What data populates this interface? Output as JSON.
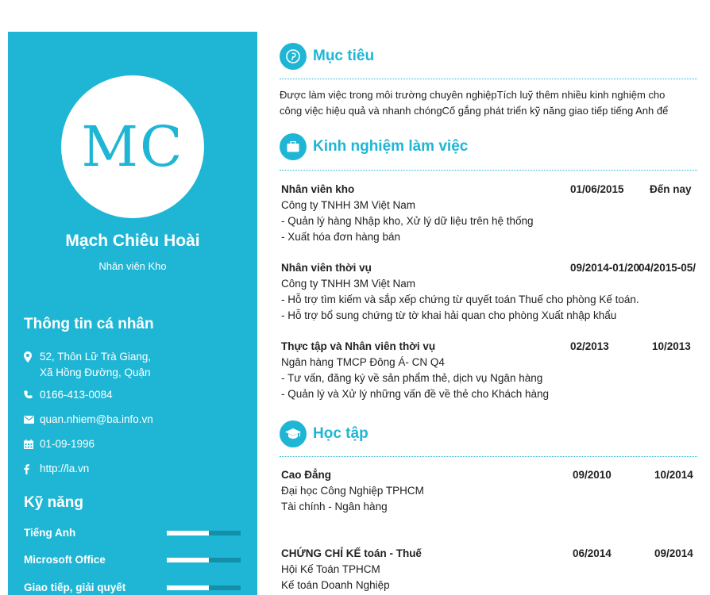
{
  "profile": {
    "initials": "MC",
    "name": "Mạch Chiêu Hoài",
    "role": "Nhân viên Kho"
  },
  "personal": {
    "heading": "Thông tin cá nhân",
    "address_line1": "52, Thôn Lữ Trà Giang,",
    "address_line2": "Xã Hồng Đường, Quận",
    "phone": "0166-413-0084",
    "email": "quan.nhiem@ba.info.vn",
    "birthday": "01-09-1996",
    "website": "http://la.vn"
  },
  "skills": {
    "heading": "Kỹ năng",
    "items": [
      {
        "label": "Tiếng Anh",
        "level": 0.57
      },
      {
        "label": "Microsoft Office",
        "level": 0.57
      },
      {
        "label": "Giao tiếp, giải quyết",
        "level": 0.57
      }
    ]
  },
  "objective": {
    "title": "Mục tiêu",
    "line1": "Được làm việc trong môi trường chuyên nghiệpTích luỹ thêm nhiều kinh nghiệm cho",
    "line2": "công việc hiệu quả và nhanh chóngCố gắng phát triển kỹ năng giao tiếp tiếng Anh để"
  },
  "experience": {
    "title": "Kinh nghiệm làm việc",
    "items": [
      {
        "title": "Nhân viên kho",
        "start": "01/06/2015",
        "end": "Đến nay",
        "company": "Công ty TNHH 3M Việt Nam",
        "lines": [
          "- Quản lý hàng Nhập kho, Xử lý dữ liệu trên hệ thống",
          "- Xuất hóa đơn hàng bán"
        ]
      },
      {
        "title": "Nhân viên thời vụ",
        "start": "09/2014-01/20",
        "end": "04/2015-05/2015",
        "company": "Công ty TNHH 3M Việt Nam",
        "lines": [
          "- Hỗ trợ tìm kiếm và sắp xếp chứng từ quyết toán Thuế cho phòng Kế toán.",
          "- Hỗ trợ bổ sung chứng từ tờ khai hải quan cho phòng Xuất nhập khẩu"
        ]
      },
      {
        "title": "Thực tập và Nhân viên thời vụ",
        "start": "02/2013",
        "end": "10/2013",
        "company": "Ngân hàng TMCP Đông Á- CN Q4",
        "lines": [
          "- Tư vấn, đăng ký về sản phẩm thẻ, dịch vụ Ngân hàng",
          "- Quản lý và Xử lý những vấn đề về thẻ cho Khách hàng"
        ]
      }
    ]
  },
  "education": {
    "title": "Học tập",
    "items": [
      {
        "title": "Cao Đẳng",
        "start": "09/2010",
        "end": "10/2014",
        "school": "Đại học Công Nghiệp TPHCM",
        "major": "Tài chính - Ngân hàng"
      },
      {
        "title": "CHỨNG CHỈ KẾ toán - Thuế",
        "start": "06/2014",
        "end": "09/2014",
        "school": "Hội Kế Toán TPHCM",
        "major": "Kế toán Doanh Nghiệp"
      }
    ]
  },
  "colors": {
    "accent": "#1fb6d5",
    "bar_track": "#138fa8"
  }
}
